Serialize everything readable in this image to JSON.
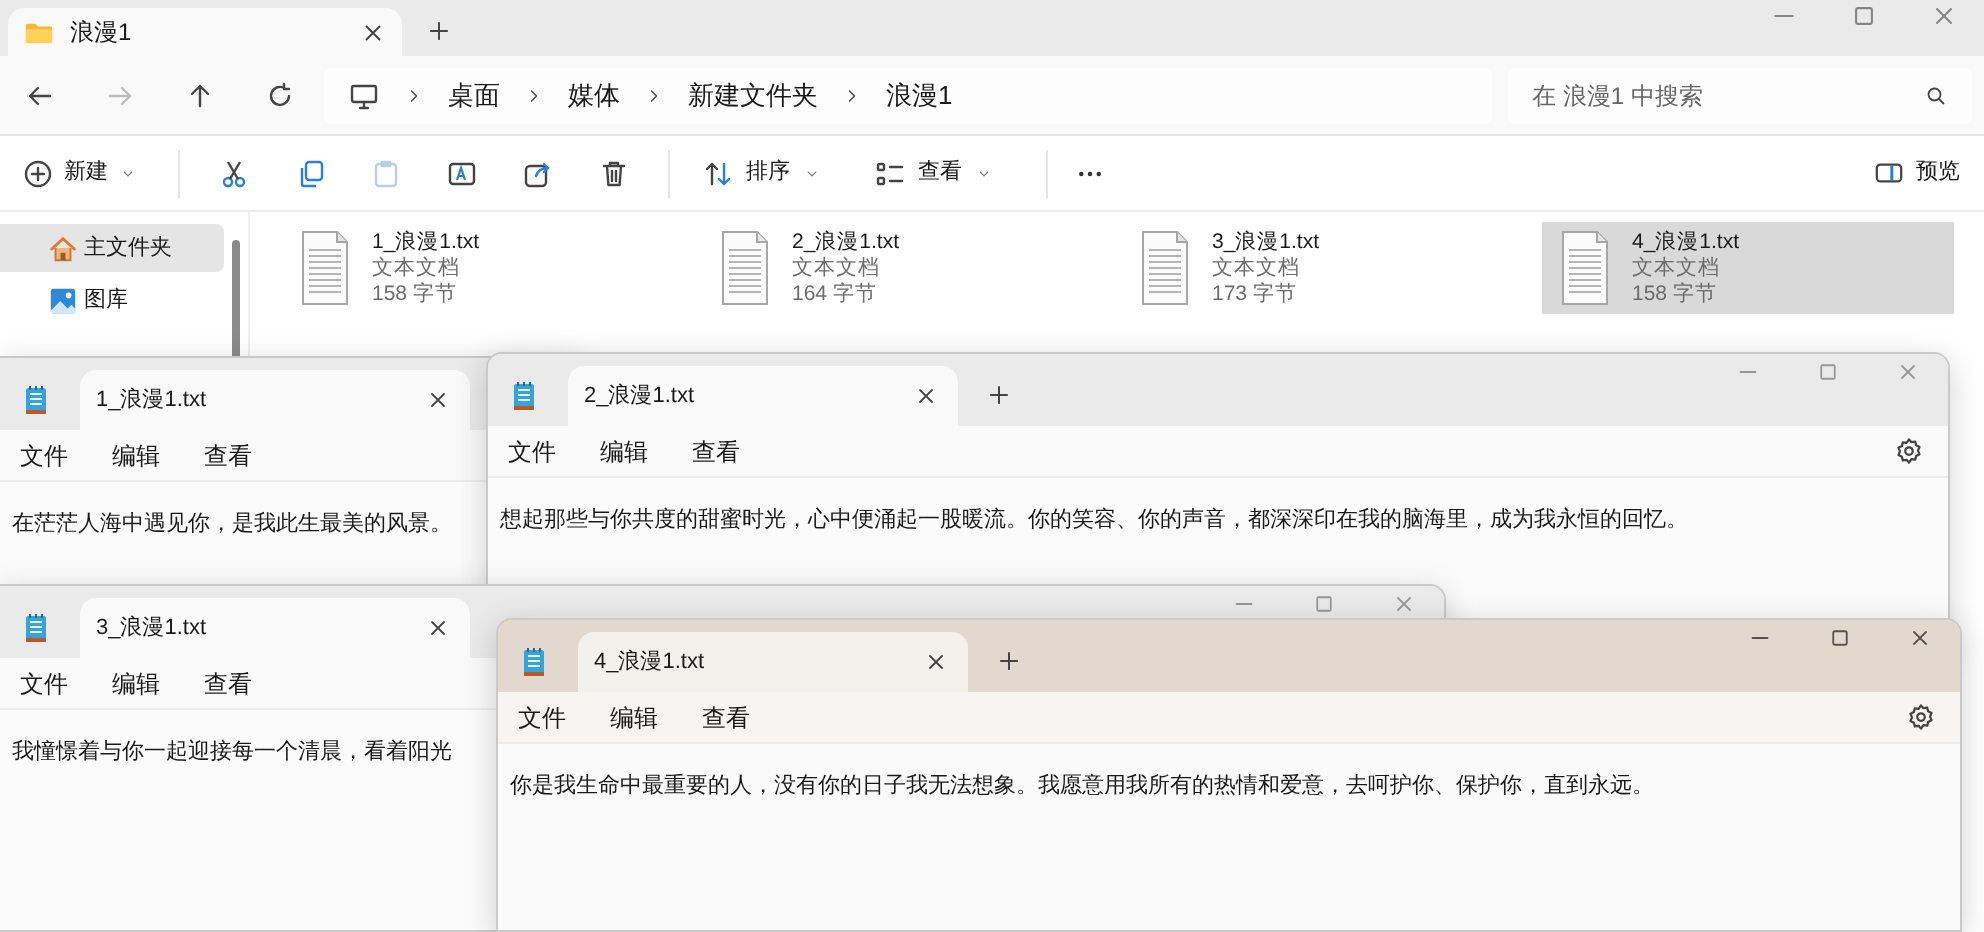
{
  "explorer": {
    "tabs": [
      {
        "label": "浪漫1",
        "selected": true
      }
    ],
    "breadcrumb": [
      "桌面",
      "媒体",
      "新建文件夹",
      "浪漫1"
    ],
    "search": {
      "placeholder": "在 浪漫1 中搜索"
    },
    "toolbar": {
      "new": "新建",
      "sort": "排序",
      "view": "查看",
      "preview": "预览"
    },
    "sidebar": [
      {
        "label": "主文件夹",
        "kind": "home",
        "selected": true
      },
      {
        "label": "图库",
        "kind": "gallery",
        "selected": false
      }
    ],
    "files": [
      {
        "name": "1_浪漫1.txt",
        "type": "文本文档",
        "size": "158 字节",
        "selected": false
      },
      {
        "name": "2_浪漫1.txt",
        "type": "文本文档",
        "size": "164 字节",
        "selected": false
      },
      {
        "name": "3_浪漫1.txt",
        "type": "文本文档",
        "size": "173 字节",
        "selected": false
      },
      {
        "name": "4_浪漫1.txt",
        "type": "文本文档",
        "size": "158 字节",
        "selected": true
      }
    ]
  },
  "notepads": [
    {
      "tab": "1_浪漫1.txt",
      "menu": [
        "文件",
        "编辑",
        "查看"
      ],
      "text": "在茫茫人海中遇见你，是我此生最美的风景。",
      "active": false
    },
    {
      "tab": "2_浪漫1.txt",
      "menu": [
        "文件",
        "编辑",
        "查看"
      ],
      "text": "想起那些与你共度的甜蜜时光，心中便涌起一股暖流。你的笑容、你的声音，都深深印在我的脑海里，成为我永恒的回忆。",
      "active": false,
      "add_tab": true,
      "window_controls": true,
      "settings": true
    },
    {
      "tab": "3_浪漫1.txt",
      "menu": [
        "文件",
        "编辑",
        "查看"
      ],
      "text": "我憧憬着与你一起迎接每一个清晨，看着阳光",
      "active": false,
      "add_tab": false,
      "window_controls": true,
      "settings": false
    },
    {
      "tab": "4_浪漫1.txt",
      "menu": [
        "文件",
        "编辑",
        "查看"
      ],
      "text": "你是我生命中最重要的人，没有你的日子我无法想象。我愿意用我所有的热情和爱意，去呵护你、保护你，直到永远。",
      "active": true,
      "add_tab": true,
      "window_controls": true,
      "settings": true
    }
  ]
}
